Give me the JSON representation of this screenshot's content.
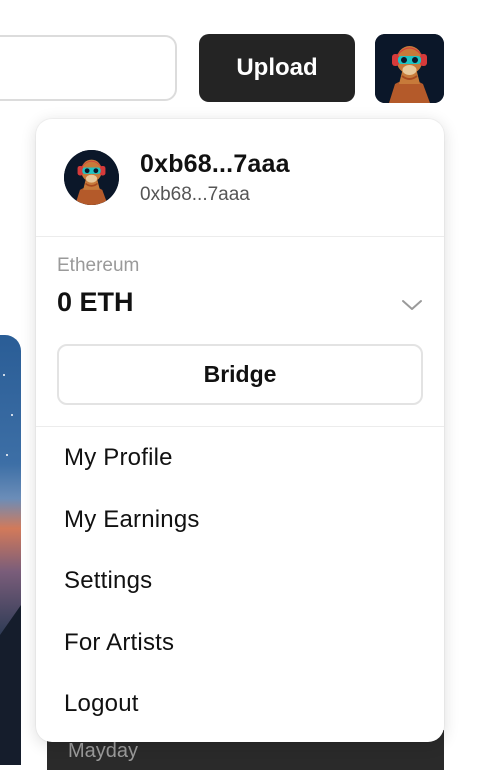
{
  "header": {
    "search_placeholder": "",
    "upload_label": "Upload",
    "avatar_icon": "llama-avatar-icon"
  },
  "account_menu": {
    "display_name": "0xb68...7aaa",
    "address": "0xb68...7aaa",
    "network_label": "Ethereum",
    "balance": "0 ETH",
    "bridge_label": "Bridge",
    "items": [
      {
        "label": "My Profile"
      },
      {
        "label": "My Earnings"
      },
      {
        "label": "Settings"
      },
      {
        "label": "For Artists"
      },
      {
        "label": "Logout"
      }
    ]
  },
  "background": {
    "card_label": "Mayday"
  },
  "colors": {
    "upload_bg": "#242424",
    "text_primary": "#111111",
    "text_muted": "#9a9a9a",
    "border": "#e3e3e3"
  }
}
